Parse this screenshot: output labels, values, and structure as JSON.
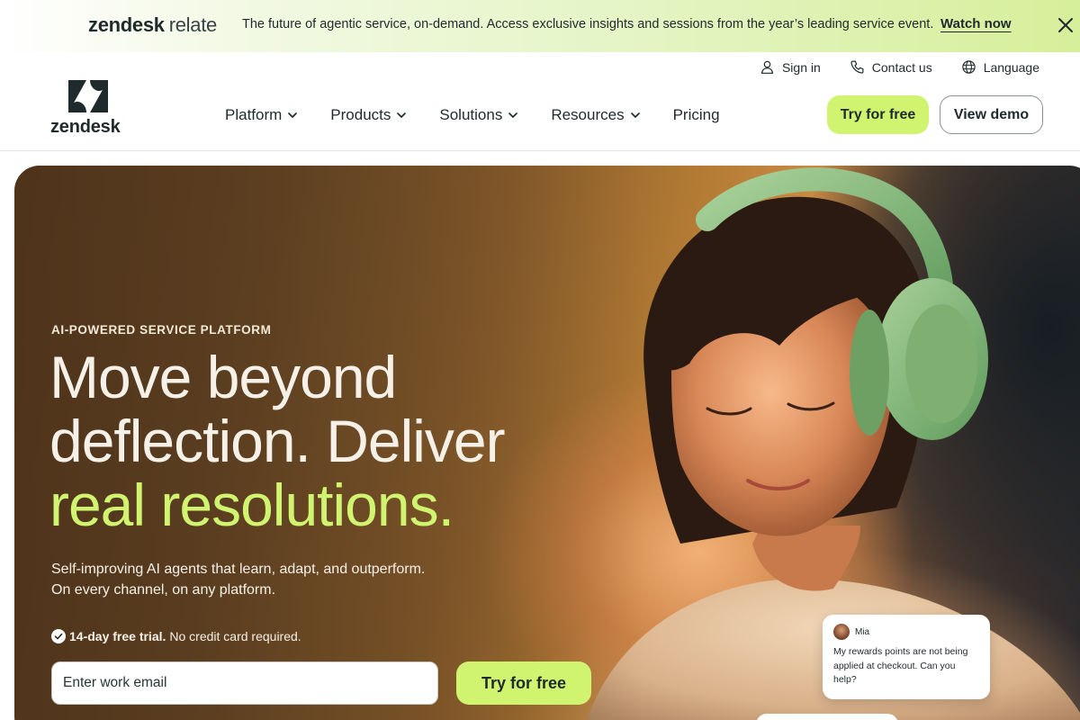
{
  "banner": {
    "brand_primary": "zendesk",
    "brand_secondary": "relate",
    "text": "The future of agentic service, on-demand. Access exclusive insights and sessions from the year’s leading service event.",
    "link_label": "Watch now",
    "close_icon": "close-icon"
  },
  "header": {
    "logo_text": "zendesk",
    "utility": [
      {
        "label": "Sign in",
        "icon": "user-icon"
      },
      {
        "label": "Contact us",
        "icon": "phone-icon"
      },
      {
        "label": "Language",
        "icon": "globe-icon"
      }
    ],
    "nav": [
      {
        "label": "Platform",
        "has_dropdown": true
      },
      {
        "label": "Products",
        "has_dropdown": true
      },
      {
        "label": "Solutions",
        "has_dropdown": true
      },
      {
        "label": "Resources",
        "has_dropdown": true
      },
      {
        "label": "Pricing",
        "has_dropdown": false
      }
    ],
    "try_button": "Try for free",
    "demo_button": "View demo"
  },
  "hero": {
    "eyebrow": "AI-POWERED SERVICE PLATFORM",
    "headline_line1": "Move beyond",
    "headline_line2": "deflection. Deliver",
    "headline_accent": "real resolutions.",
    "subhead_line1": "Self-improving AI agents that learn, adapt, and outperform.",
    "subhead_line2": "On every channel, on any platform.",
    "trial_bold": "14-day free trial.",
    "trial_rest": "No credit card required.",
    "email_placeholder": "Enter work email",
    "try_button": "Try for free",
    "chat": {
      "name": "Mia",
      "message": "My rewards points are not being applied at checkout. Can you help?"
    }
  },
  "colors": {
    "accent": "#d1f470",
    "text_dark": "#1f2a2c",
    "hero_text": "#f6f1e8"
  }
}
